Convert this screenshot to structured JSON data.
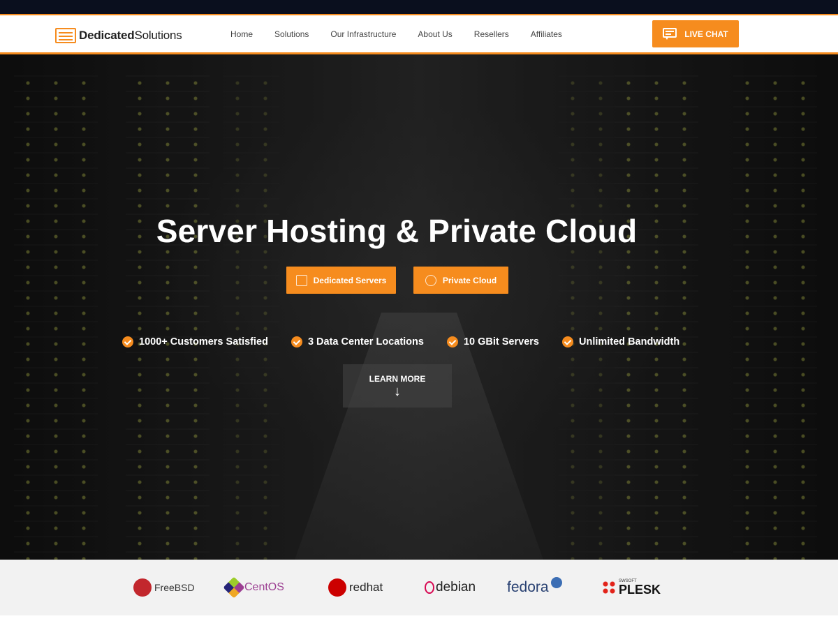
{
  "brand": {
    "name_bold": "Dedicated",
    "name_regular": "Solutions",
    "accent_color": "#f68c1e"
  },
  "nav": {
    "items": [
      "Home",
      "Solutions",
      "Our Infrastructure",
      "About Us",
      "Resellers",
      "Affiliates"
    ],
    "live_chat_label": "LIVE CHAT"
  },
  "hero": {
    "title": "Server Hosting & Private Cloud",
    "buttons": {
      "dedicated": "Dedicated Servers",
      "private_cloud": "Private Cloud"
    },
    "features": [
      "1000+ Customers Satisfied",
      "3 Data Center Locations",
      "10 GBit Servers",
      "Unlimited Bandwidth"
    ],
    "learn_more": "LEARN MORE",
    "learn_more_arrow": "↓"
  },
  "os_logos": [
    {
      "name": "FreeBSD",
      "icon": "freebsd-icon",
      "color": "#c2272d"
    },
    {
      "name": "CentOS",
      "icon": "centos-icon",
      "color": "#9c3f92"
    },
    {
      "name": "redhat",
      "icon": "redhat-icon",
      "color": "#cc0000"
    },
    {
      "name": "debian",
      "icon": "debian-icon",
      "color": "#d70751"
    },
    {
      "name": "fedora",
      "icon": "fedora-icon",
      "color": "#294172"
    },
    {
      "name": "PLESK",
      "icon": "plesk-icon",
      "color": "#e2231a",
      "prefix": "SWSOFT"
    }
  ]
}
